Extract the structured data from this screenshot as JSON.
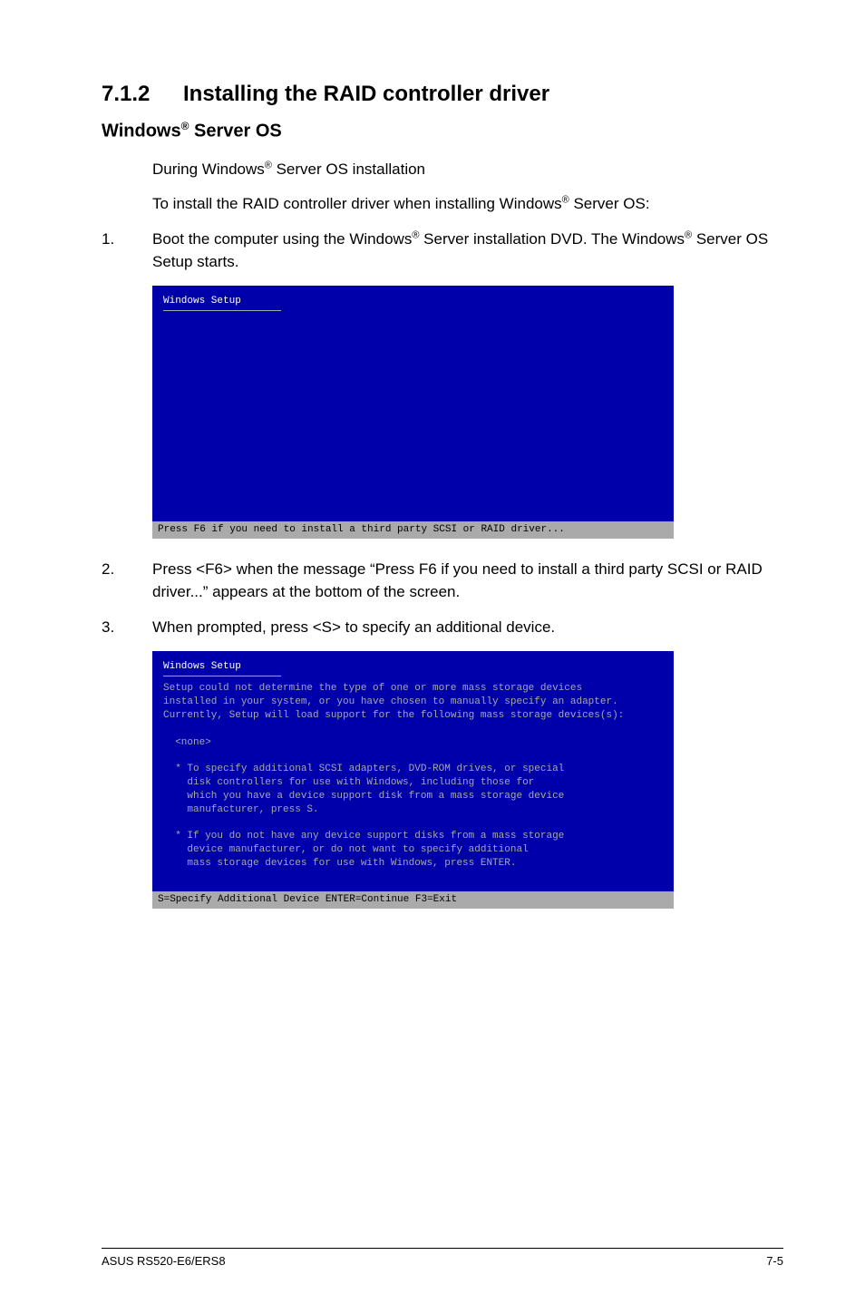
{
  "section": {
    "number": "7.1.2",
    "title": "Installing the RAID controller driver"
  },
  "subheading": {
    "prefix": "Windows",
    "suffix": " Server OS"
  },
  "intro": {
    "line1_pre": "During Windows",
    "line1_post": " Server OS installation",
    "line2_pre": "To install the RAID controller driver when installing Windows",
    "line2_post": " Server OS:"
  },
  "steps": {
    "s1": {
      "num": "1.",
      "t1": "Boot the computer using the Windows",
      "t2": " Server installation DVD. The Windows",
      "t3": " Server OS Setup starts."
    },
    "s2": {
      "num": "2.",
      "text": "Press <F6> when the message “Press F6 if you need to install a third party SCSI or RAID driver...” appears at the bottom of the screen."
    },
    "s3": {
      "num": "3.",
      "text": "When prompted, press <S> to specify an additional device."
    }
  },
  "shot1": {
    "title": "Windows Setup",
    "status": "Press F6 if you need to install a third party SCSI or RAID driver..."
  },
  "shot2": {
    "title": "Windows Setup",
    "body": "Setup could not determine the type of one or more mass storage devices\ninstalled in your system, or you have chosen to manually specify an adapter.\nCurrently, Setup will load support for the following mass storage devices(s):\n\n  <none>\n\n  * To specify additional SCSI adapters, DVD-ROM drives, or special\n    disk controllers for use with Windows, including those for\n    which you have a device support disk from a mass storage device\n    manufacturer, press S.\n\n  * If you do not have any device support disks from a mass storage\n    device manufacturer, or do not want to specify additional\n    mass storage devices for use with Windows, press ENTER.\n\n",
    "status": "S=Specify Additional Device    ENTER=Continue    F3=Exit"
  },
  "footer": {
    "left": "ASUS RS520-E6/ERS8",
    "right": "7-5"
  }
}
